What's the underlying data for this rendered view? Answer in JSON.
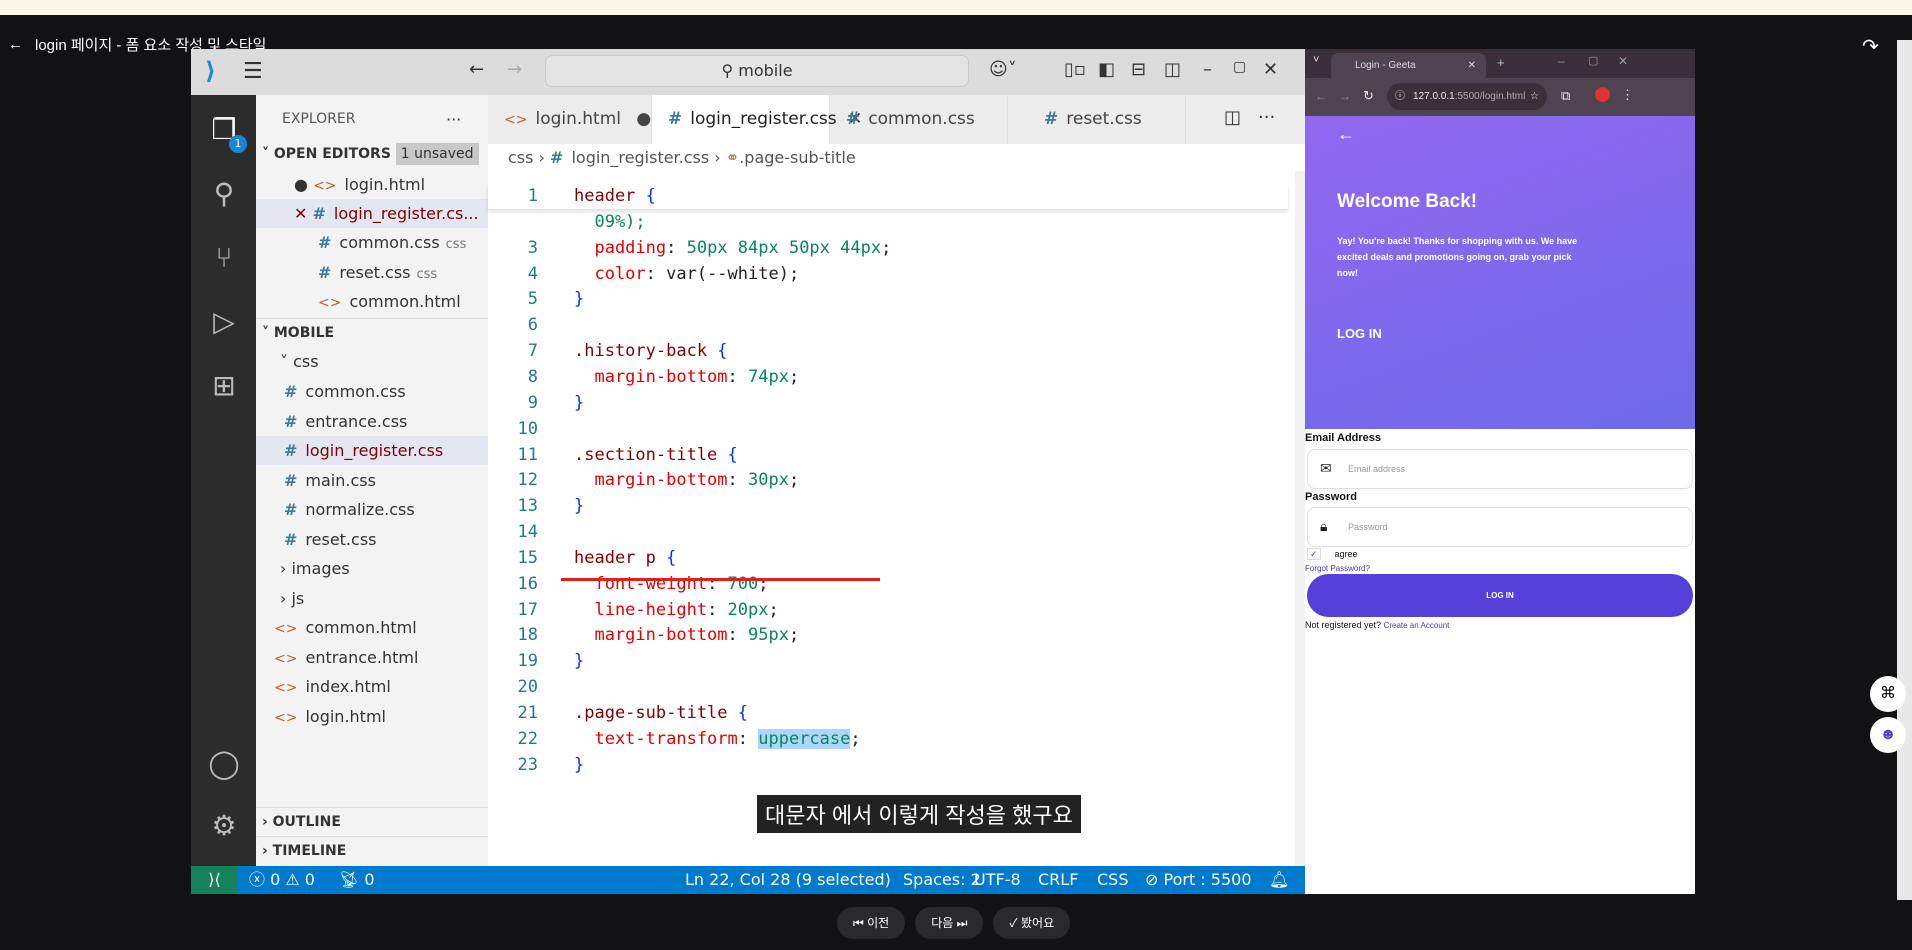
{
  "player": {
    "title": "login 페이지 - 폼 요소 작성 및 스타일",
    "subtitle": "대문자 에서 이렇게 작성을 했구요",
    "prev": "이전",
    "next": "다음",
    "done": "봤어요"
  },
  "vscode": {
    "search": "mobile",
    "explorer_title": "EXPLORER",
    "open_editors": {
      "label": "OPEN EDITORS",
      "badge": "1 unsaved",
      "items": [
        {
          "name": "login.html",
          "type": "html",
          "state": "modified"
        },
        {
          "name": "login_register.cs...",
          "type": "css",
          "state": "active"
        },
        {
          "name": "common.css",
          "type": "css",
          "hint": "css"
        },
        {
          "name": "reset.css",
          "type": "css",
          "hint": "css"
        },
        {
          "name": "common.html",
          "type": "html"
        }
      ]
    },
    "workspace": {
      "label": "MOBILE",
      "css_folder": "css",
      "css_files": [
        "common.css",
        "entrance.css",
        "login_register.css",
        "main.css",
        "normalize.css",
        "reset.css"
      ],
      "folders": [
        "images",
        "js"
      ],
      "files": [
        "common.html",
        "entrance.html",
        "index.html",
        "login.html"
      ]
    },
    "outline": "OUTLINE",
    "timeline": "TIMELINE",
    "tabs": [
      {
        "label": "login.html",
        "type": "html"
      },
      {
        "label": "login_register.css",
        "type": "css",
        "active": true
      },
      {
        "label": "common.css",
        "type": "css"
      },
      {
        "label": "reset.css",
        "type": "css"
      }
    ],
    "breadcrumb": [
      "css",
      "login_register.css",
      ".page-sub-title"
    ],
    "code": [
      {
        "n": "1",
        "s": [
          [
            "header",
            "sel"
          ],
          [
            " ",
            ""
          ],
          [
            "{",
            "br"
          ]
        ]
      },
      {
        "n": "",
        "s": [
          [
            "  09%);",
            "val"
          ]
        ]
      },
      {
        "n": "3",
        "s": [
          [
            "  padding",
            "prop"
          ],
          [
            ": ",
            "pun"
          ],
          [
            "50px 84px 50px 44px",
            "val"
          ],
          [
            ";",
            "pun"
          ]
        ]
      },
      {
        "n": "4",
        "s": [
          [
            "  color",
            "prop"
          ],
          [
            ": var(--white);",
            "pun"
          ]
        ]
      },
      {
        "n": "5",
        "s": [
          [
            "}",
            "br"
          ]
        ]
      },
      {
        "n": "6",
        "s": []
      },
      {
        "n": "7",
        "s": [
          [
            ".history-back ",
            "sel"
          ],
          [
            "{",
            "br"
          ]
        ]
      },
      {
        "n": "8",
        "s": [
          [
            "  margin-bottom",
            "prop"
          ],
          [
            ": ",
            "pun"
          ],
          [
            "74px",
            "val"
          ],
          [
            ";",
            "pun"
          ]
        ]
      },
      {
        "n": "9",
        "s": [
          [
            "}",
            "br"
          ]
        ]
      },
      {
        "n": "10",
        "s": []
      },
      {
        "n": "11",
        "s": [
          [
            ".section-title ",
            "sel"
          ],
          [
            "{",
            "br"
          ]
        ]
      },
      {
        "n": "12",
        "s": [
          [
            "  margin-bottom",
            "prop"
          ],
          [
            ": ",
            "pun"
          ],
          [
            "30px",
            "val"
          ],
          [
            ";",
            "pun"
          ]
        ]
      },
      {
        "n": "13",
        "s": [
          [
            "}",
            "br"
          ]
        ]
      },
      {
        "n": "14",
        "s": []
      },
      {
        "n": "15",
        "s": [
          [
            "header p ",
            "sel"
          ],
          [
            "{",
            "br"
          ]
        ]
      },
      {
        "n": "16",
        "s": [
          [
            "  font-weight",
            "prop"
          ],
          [
            ": ",
            "pun"
          ],
          [
            "700",
            "val"
          ],
          [
            ";",
            "pun"
          ]
        ]
      },
      {
        "n": "17",
        "s": [
          [
            "  line-height",
            "prop"
          ],
          [
            ": ",
            "pun"
          ],
          [
            "20px",
            "val"
          ],
          [
            ";",
            "pun"
          ]
        ]
      },
      {
        "n": "18",
        "s": [
          [
            "  margin-bottom",
            "prop"
          ],
          [
            ": ",
            "pun"
          ],
          [
            "95px",
            "val"
          ],
          [
            ";",
            "pun"
          ]
        ]
      },
      {
        "n": "19",
        "s": [
          [
            "}",
            "br"
          ]
        ]
      },
      {
        "n": "20",
        "s": []
      },
      {
        "n": "21",
        "s": [
          [
            ".page-sub-title ",
            "sel"
          ],
          [
            "{",
            "br"
          ]
        ]
      },
      {
        "n": "22",
        "s": [
          [
            "  text-transform",
            "prop"
          ],
          [
            ": ",
            "pun"
          ],
          [
            "uppercase",
            "val hl"
          ],
          [
            ";",
            "pun"
          ]
        ]
      },
      {
        "n": "23",
        "s": [
          [
            "}",
            "br"
          ]
        ]
      }
    ],
    "status": {
      "errors": "0",
      "warnings": "0",
      "ports": "0",
      "position": "Ln 22, Col 28 (9 selected)",
      "spaces": "Spaces: 2",
      "encoding": "UTF-8",
      "eol": "CRLF",
      "lang": "CSS",
      "port": "Port : 5500"
    },
    "activity_badge": "1"
  },
  "browser": {
    "tab_title": "Login - Geeta",
    "url_host": "127.0.0.1",
    "url_rest": ":5500/login.html",
    "welcome": "Welcome Back!",
    "desc": "Yay! You're back! Thanks for shopping with us. We have excited deals and promotions going on, grab your pick now!",
    "page_title": "LOG IN",
    "email_label": "Email Address",
    "email_placeholder": "Email address",
    "password_label": "Password",
    "password_placeholder": "Password",
    "agree": "agree",
    "forgot": "Forgot Password?",
    "login_btn": "LOG IN",
    "not_registered": "Not registered yet?",
    "create": "Create an Account",
    "accent": "#5540d8"
  }
}
